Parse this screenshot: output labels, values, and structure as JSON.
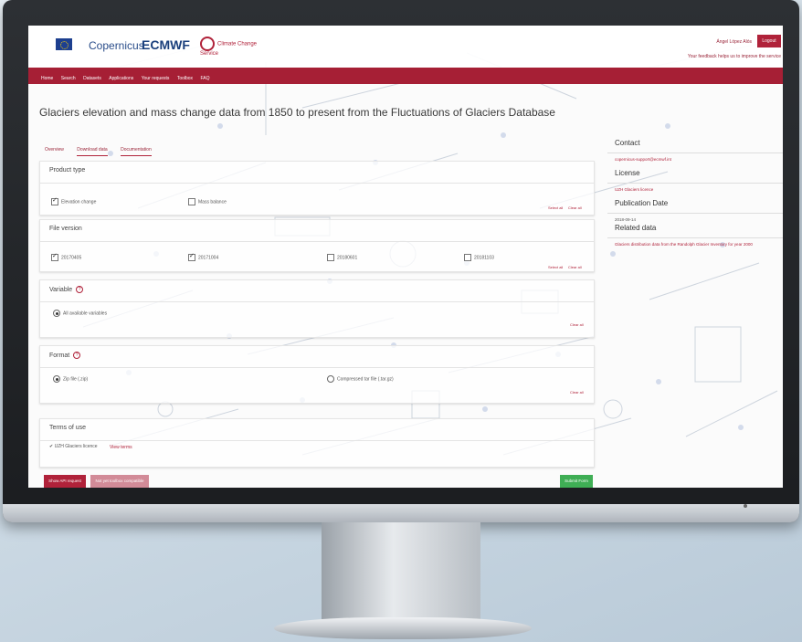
{
  "header": {
    "logos": [
      "eu-flag-icon",
      "Copernicus",
      "ECMWF",
      "Climate Change Service"
    ],
    "user_name": "Ángel López Alós",
    "logout_label": "Logout",
    "feedback_text": "Your feedback helps us to improve the service"
  },
  "nav": {
    "items": [
      "Home",
      "Search",
      "Datasets",
      "Applications",
      "Your requests",
      "Toolbox",
      "FAQ"
    ]
  },
  "page_title": "Glaciers elevation and mass change data from 1850 to present from the Fluctuations of Glaciers Database",
  "tabs": [
    {
      "label": "Overview",
      "active": false
    },
    {
      "label": "Download data",
      "active": true
    },
    {
      "label": "Documentation",
      "active": false
    }
  ],
  "product_type": {
    "title": "Product type",
    "options": [
      {
        "label": "Elevation change",
        "checked": true
      },
      {
        "label": "Mass balance",
        "checked": false
      }
    ],
    "select_all": "Select all",
    "clear_all": "Clear all"
  },
  "file_version": {
    "title": "File version",
    "options": [
      {
        "label": "20170405",
        "checked": true
      },
      {
        "label": "20171004",
        "checked": true
      },
      {
        "label": "20180601",
        "checked": false
      },
      {
        "label": "20181103",
        "checked": false
      }
    ],
    "select_all": "Select all",
    "clear_all": "Clear all"
  },
  "variable": {
    "title": "Variable",
    "options": [
      {
        "label": "All available variables",
        "selected": true
      }
    ],
    "clear_all": "Clear all"
  },
  "format": {
    "title": "Format",
    "options": [
      {
        "label": "Zip file (.zip)",
        "selected": true
      },
      {
        "label": "Compressed tar file (.tar.gz)",
        "selected": false
      }
    ],
    "clear_all": "Clear all"
  },
  "terms": {
    "title": "Terms of use",
    "item": "UZH Glaciers licence",
    "view_terms": "View terms"
  },
  "sidebar": {
    "contact_title": "Contact",
    "contact_value": "copernicus-support@ecmwf.int",
    "license_title": "License",
    "license_value": "UZH Glaciers licence",
    "pub_title": "Publication Date",
    "pub_value": "2018-09-14",
    "related_title": "Related data",
    "related_value": "Glaciers distribution data from the Randolph Glacier Inventory for year 2000"
  },
  "buttons": {
    "api": "Show API request",
    "toolbox": "Not yet toolbox compatible",
    "submit": "Submit Form"
  },
  "colors": {
    "brand": "#a61f35",
    "submit": "#3fae55"
  }
}
